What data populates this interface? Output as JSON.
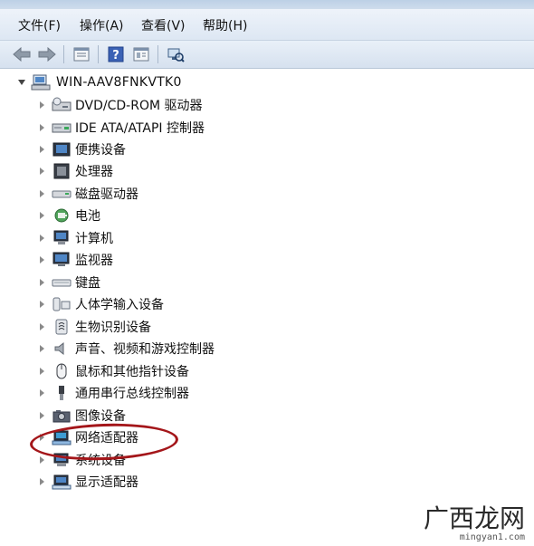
{
  "menu": [
    {
      "label": "文件(F)"
    },
    {
      "label": "操作(A)"
    },
    {
      "label": "查看(V)"
    },
    {
      "label": "帮助(H)"
    }
  ],
  "toolbar": {
    "buttons": [
      "back-arrow-icon",
      "forward-arrow-icon",
      "properties-icon",
      "help-icon",
      "view-icon",
      "scan-hardware-icon"
    ]
  },
  "tree": {
    "root": {
      "label": "WIN-AAV8FNKVTK0",
      "icon": "computer-icon"
    },
    "items": [
      {
        "label": "DVD/CD-ROM 驱动器",
        "icon": "dvd-drive-icon"
      },
      {
        "label": "IDE ATA/ATAPI 控制器",
        "icon": "ide-controller-icon"
      },
      {
        "label": "便携设备",
        "icon": "portable-device-icon"
      },
      {
        "label": "处理器",
        "icon": "processor-icon"
      },
      {
        "label": "磁盘驱动器",
        "icon": "disk-drive-icon"
      },
      {
        "label": "电池",
        "icon": "battery-icon"
      },
      {
        "label": "计算机",
        "icon": "computer-icon"
      },
      {
        "label": "监视器",
        "icon": "monitor-icon"
      },
      {
        "label": "键盘",
        "icon": "keyboard-icon"
      },
      {
        "label": "人体学输入设备",
        "icon": "hid-icon"
      },
      {
        "label": "生物识别设备",
        "icon": "biometric-icon"
      },
      {
        "label": "声音、视频和游戏控制器",
        "icon": "sound-icon"
      },
      {
        "label": "鼠标和其他指针设备",
        "icon": "mouse-icon"
      },
      {
        "label": "通用串行总线控制器",
        "icon": "usb-icon"
      },
      {
        "label": "图像设备",
        "icon": "camera-icon"
      },
      {
        "label": "网络适配器",
        "icon": "network-adapter-icon"
      },
      {
        "label": "系统设备",
        "icon": "system-device-icon"
      },
      {
        "label": "显示适配器",
        "icon": "display-adapter-icon"
      }
    ]
  },
  "highlight": {
    "color": "#a4161a",
    "target": "网络适配器"
  },
  "watermark": {
    "text": "广西龙网",
    "url": "mingyan1.com"
  },
  "colors": {
    "menubar": "#e4ecf6",
    "toolbar": "#dde7f3",
    "accent": "#a4161a"
  }
}
